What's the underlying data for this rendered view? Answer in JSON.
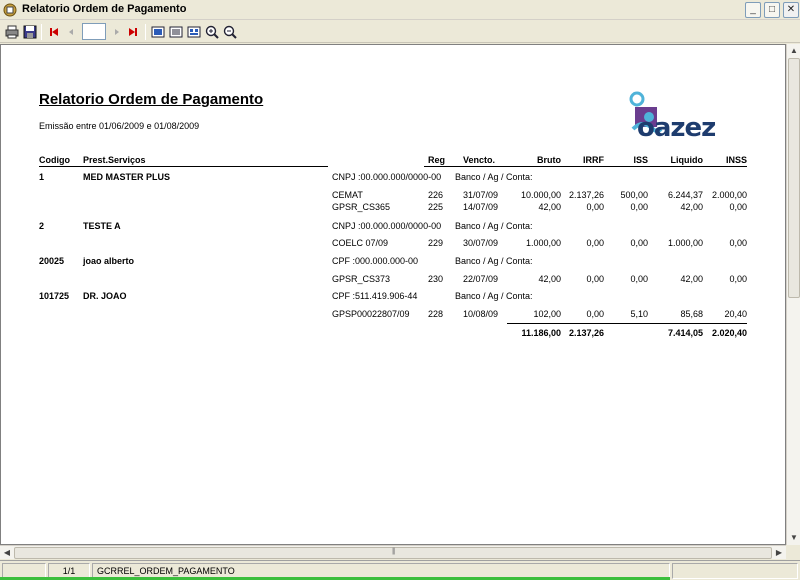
{
  "window": {
    "title": "Relatorio Ordem de Pagamento",
    "controls": [
      "_",
      "□",
      "✕"
    ]
  },
  "toolbar": {
    "icons": [
      "print-icon",
      "save-icon",
      "first-page-icon",
      "prev-page-icon",
      "next-page-icon",
      "last-page-icon",
      "single-page-icon",
      "multi-page-icon",
      "page-setup-icon",
      "zoom-in-icon",
      "zoom-out-icon"
    ],
    "page_value": ""
  },
  "report": {
    "title": "Relatorio Ordem de Pagamento",
    "subtitle": "Emissão entre 01/06/2009 e 01/08/2009",
    "logo_text": "oazez",
    "columns": {
      "codigo": "Codigo",
      "prest": "Prest.Serviços",
      "reg": "Reg",
      "vencto": "Vencto.",
      "bruto": "Bruto",
      "irrf": "IRRF",
      "iss": "ISS",
      "liquido": "Liquido",
      "inss": "INSS"
    },
    "groups": [
      {
        "codigo": "1",
        "nome": "MED MASTER PLUS",
        "doc": "CNPJ :00.000.000/0000-00",
        "banco": "Banco / Ag / Conta:",
        "items": [
          {
            "desc": "CEMAT",
            "reg": "226",
            "vencto": "31/07/09",
            "bruto": "10.000,00",
            "irrf": "2.137,26",
            "iss": "500,00",
            "liquido": "6.244,37",
            "inss": "2.000,00"
          },
          {
            "desc": "GPSR_CS365",
            "reg": "225",
            "vencto": "14/07/09",
            "bruto": "42,00",
            "irrf": "0,00",
            "iss": "0,00",
            "liquido": "42,00",
            "inss": "0,00"
          }
        ]
      },
      {
        "codigo": "2",
        "nome": "TESTE A",
        "doc": "CNPJ :00.000.000/0000-00",
        "banco": "Banco / Ag / Conta:",
        "items": [
          {
            "desc": "COELC 07/09",
            "reg": "229",
            "vencto": "30/07/09",
            "bruto": "1.000,00",
            "irrf": "0,00",
            "iss": "0,00",
            "liquido": "1.000,00",
            "inss": "0,00"
          }
        ]
      },
      {
        "codigo": "20025",
        "nome": "joao alberto",
        "doc": "CPF :000.000.000-00",
        "banco": "Banco / Ag / Conta:",
        "items": [
          {
            "desc": "GPSR_CS373",
            "reg": "230",
            "vencto": "22/07/09",
            "bruto": "42,00",
            "irrf": "0,00",
            "iss": "0,00",
            "liquido": "42,00",
            "inss": "0,00"
          }
        ]
      },
      {
        "codigo": "101725",
        "nome": "DR. JOAO",
        "doc": "CPF :511.419.906-44",
        "banco": "Banco / Ag / Conta:",
        "items": [
          {
            "desc": "GPSP00022807/09",
            "reg": "228",
            "vencto": "10/08/09",
            "bruto": "102,00",
            "irrf": "0,00",
            "iss": "5,10",
            "liquido": "85,68",
            "inss": "20,40"
          }
        ]
      }
    ],
    "totals": {
      "bruto": "11.186,00",
      "irrf": "2.137,26",
      "liquido": "7.414,05",
      "inss": "2.020,40"
    }
  },
  "statusbar": {
    "page": "1/1",
    "report_name": "GCRREL_ORDEM_PAGAMENTO"
  },
  "colors": {
    "logo_dark": "#1e3c6e",
    "logo_light": "#4fb3d9",
    "logo_purple": "#6a3d8f"
  }
}
